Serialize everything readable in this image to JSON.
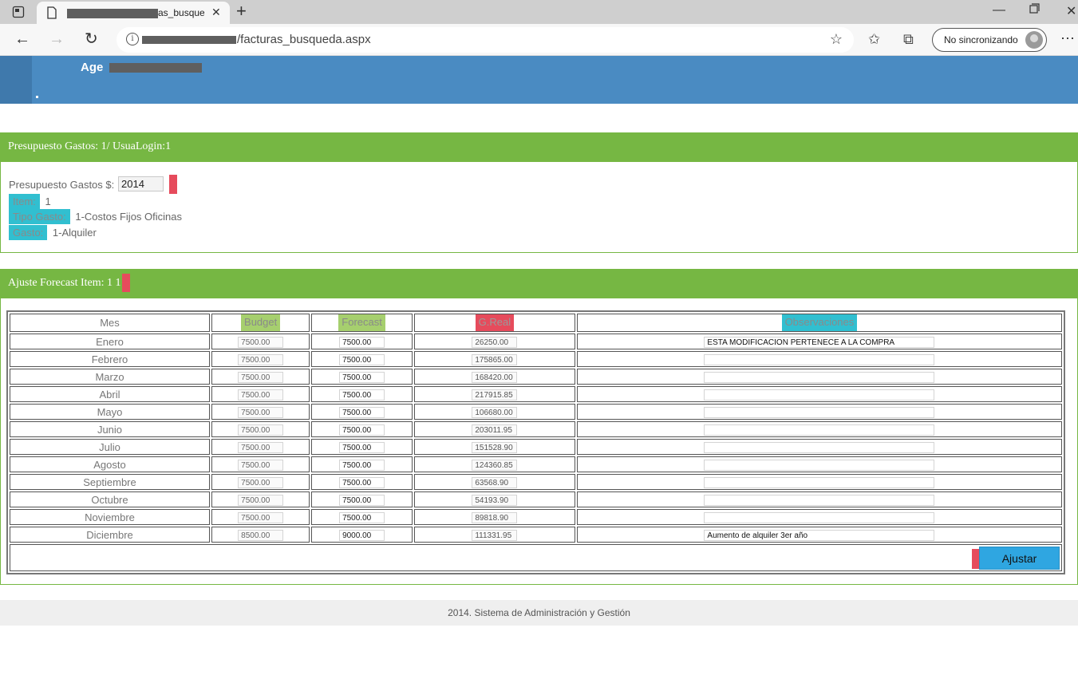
{
  "browser": {
    "tab_title": "as_busque",
    "url": "/facturas_busqueda.aspx",
    "sync_label": "No sincronizando"
  },
  "header": {
    "brand": "Age"
  },
  "section1": {
    "title": "Presupuesto Gastos: 1/ UsuaLogin:1",
    "budget_label": "Presupuesto Gastos $:",
    "year": "2014",
    "item_label": "Item:",
    "item_value": "1",
    "tipo_label": "Tipo Gasto:",
    "tipo_value": "1-Costos Fijos Oficinas",
    "gasto_label": "Gasto:",
    "gasto_value": "1-Alquiler"
  },
  "section2": {
    "title": "Ajuste Forecast Item: 1 1",
    "columns": [
      "Mes",
      "Budget",
      "Forecast",
      "G.Real",
      "Observaciones"
    ],
    "rows": [
      {
        "mes": "Enero",
        "budget": "7500.00",
        "forecast": "7500.00",
        "real": "26250.00",
        "obs": "ESTA MODIFICACION PERTENECE A LA COMPRA"
      },
      {
        "mes": "Febrero",
        "budget": "7500.00",
        "forecast": "7500.00",
        "real": "175865.00",
        "obs": ""
      },
      {
        "mes": "Marzo",
        "budget": "7500.00",
        "forecast": "7500.00",
        "real": "168420.00",
        "obs": ""
      },
      {
        "mes": "Abril",
        "budget": "7500.00",
        "forecast": "7500.00",
        "real": "217915.85",
        "obs": ""
      },
      {
        "mes": "Mayo",
        "budget": "7500.00",
        "forecast": "7500.00",
        "real": "106680.00",
        "obs": ""
      },
      {
        "mes": "Junio",
        "budget": "7500.00",
        "forecast": "7500.00",
        "real": "203011.95",
        "obs": ""
      },
      {
        "mes": "Julio",
        "budget": "7500.00",
        "forecast": "7500.00",
        "real": "151528.90",
        "obs": ""
      },
      {
        "mes": "Agosto",
        "budget": "7500.00",
        "forecast": "7500.00",
        "real": "124360.85",
        "obs": ""
      },
      {
        "mes": "Septiembre",
        "budget": "7500.00",
        "forecast": "7500.00",
        "real": "63568.90",
        "obs": ""
      },
      {
        "mes": "Octubre",
        "budget": "7500.00",
        "forecast": "7500.00",
        "real": "54193.90",
        "obs": ""
      },
      {
        "mes": "Noviembre",
        "budget": "7500.00",
        "forecast": "7500.00",
        "real": "89818.90",
        "obs": ""
      },
      {
        "mes": "Diciembre",
        "budget": "8500.00",
        "forecast": "9000.00",
        "real": "111331.95",
        "obs": "Aumento de alquiler 3er año"
      }
    ],
    "button_label": "Ajustar"
  },
  "footer": {
    "text": "2014. Sistema de Administración y Gestión"
  },
  "colors": {
    "header_blue": "#4a8bc2",
    "panel_green": "#76b743",
    "chip_cyan": "#31bfd0",
    "chip_green": "#a6cf6e",
    "chip_red": "#e64b5c",
    "button_blue": "#2fa6e1"
  }
}
